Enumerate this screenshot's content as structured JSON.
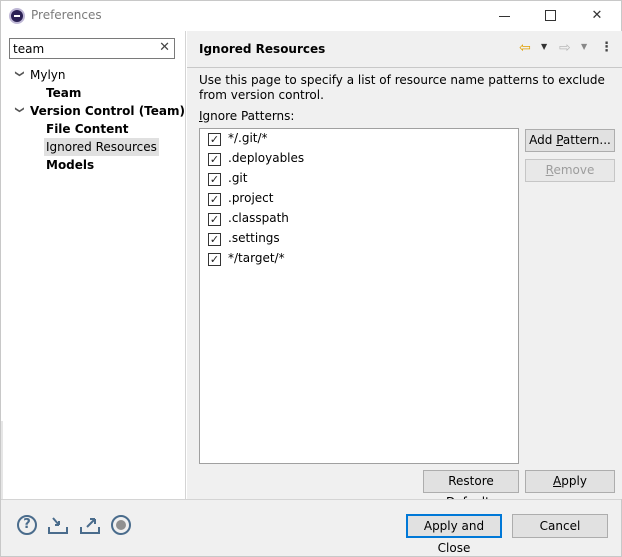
{
  "window": {
    "title": "Preferences"
  },
  "filter": {
    "value": "team",
    "clear_glyph": "✕"
  },
  "tree": [
    {
      "label": "Mylyn",
      "level": 0,
      "expanded": true,
      "bold": false
    },
    {
      "label": "Team",
      "level": 1,
      "bold": true
    },
    {
      "label": "Version Control (Team)",
      "level": 0,
      "expanded": true,
      "bold": true
    },
    {
      "label": "File Content",
      "level": 1,
      "bold": true
    },
    {
      "label": "Ignored Resources",
      "level": 1,
      "bold": false,
      "selected": true
    },
    {
      "label": "Models",
      "level": 1,
      "bold": true
    }
  ],
  "page": {
    "title": "Ignored Resources",
    "description": "Use this page to specify a list of resource name patterns to exclude from version control.",
    "patterns_label_mnemonic": "I",
    "patterns_label_rest": "gnore Patterns:",
    "patterns": [
      {
        "text": "*/.git/*",
        "checked": true
      },
      {
        "text": ".deployables",
        "checked": true
      },
      {
        "text": ".git",
        "checked": true
      },
      {
        "text": ".project",
        "checked": true
      },
      {
        "text": ".classpath",
        "checked": true
      },
      {
        "text": ".settings",
        "checked": true
      },
      {
        "text": "*/target/*",
        "checked": true
      }
    ],
    "add_button_pre": "Add ",
    "add_button_mnemonic": "P",
    "add_button_post": "attern...",
    "remove_button_mnemonic": "R",
    "remove_button_rest": "emove",
    "restore_pre": "Restore ",
    "restore_mnemonic": "D",
    "restore_post": "efaults",
    "apply_mnemonic": "A",
    "apply_rest": "pply"
  },
  "footer": {
    "apply_close_label": "Apply and Close",
    "cancel_label": "Cancel"
  },
  "colors": {
    "accent": "#0078d7",
    "nav_back": "#e0a000"
  }
}
